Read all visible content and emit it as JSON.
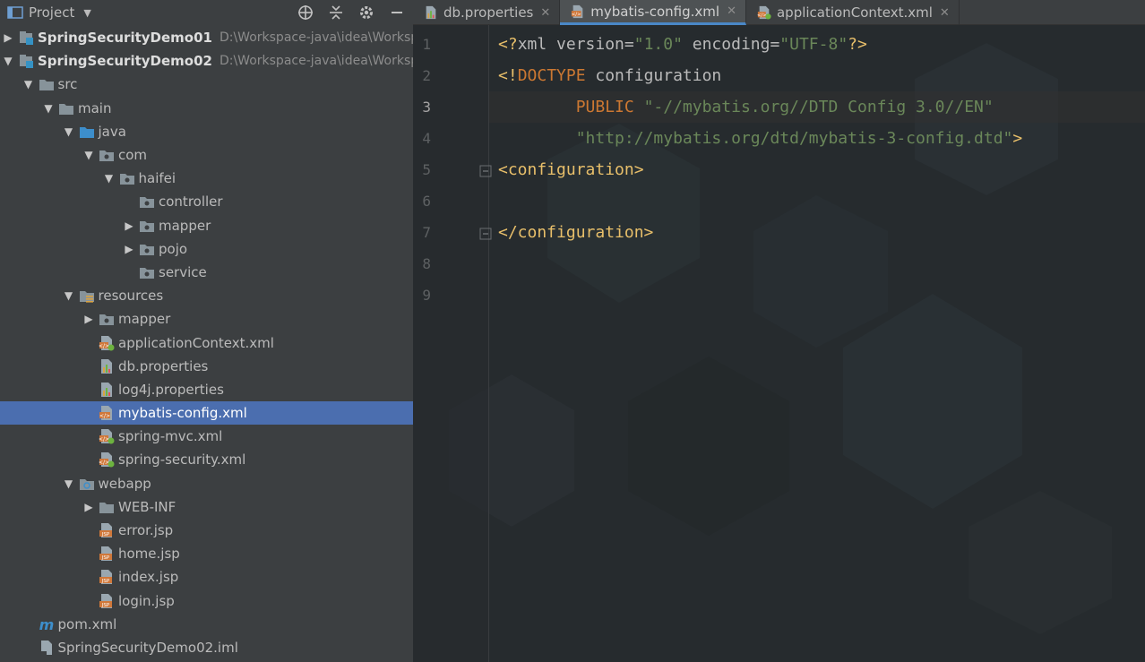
{
  "project_panel": {
    "title": "Project",
    "tree": [
      {
        "label": "SpringSecurityDemo01",
        "path": "D:\\Workspace-java\\idea\\Worksp",
        "depth": 0,
        "arrow": "right",
        "icon": "module-icon",
        "bold": true
      },
      {
        "label": "SpringSecurityDemo02",
        "path": "D:\\Workspace-java\\idea\\Worksp",
        "depth": 0,
        "arrow": "down",
        "icon": "module-icon",
        "bold": true
      },
      {
        "label": "src",
        "depth": 1,
        "arrow": "down",
        "icon": "folder-icon"
      },
      {
        "label": "main",
        "depth": 2,
        "arrow": "down",
        "icon": "folder-icon"
      },
      {
        "label": "java",
        "depth": 3,
        "arrow": "down",
        "icon": "source-folder-icon"
      },
      {
        "label": "com",
        "depth": 4,
        "arrow": "down",
        "icon": "package-icon"
      },
      {
        "label": "haifei",
        "depth": 5,
        "arrow": "down",
        "icon": "package-icon"
      },
      {
        "label": "controller",
        "depth": 6,
        "arrow": "none",
        "icon": "package-icon"
      },
      {
        "label": "mapper",
        "depth": 6,
        "arrow": "right",
        "icon": "package-icon"
      },
      {
        "label": "pojo",
        "depth": 6,
        "arrow": "right",
        "icon": "package-icon"
      },
      {
        "label": "service",
        "depth": 6,
        "arrow": "none",
        "icon": "package-icon"
      },
      {
        "label": "resources",
        "depth": 3,
        "arrow": "down",
        "icon": "resources-folder-icon"
      },
      {
        "label": "mapper",
        "depth": 4,
        "arrow": "right",
        "icon": "package-icon"
      },
      {
        "label": "applicationContext.xml",
        "depth": 4,
        "arrow": "none",
        "icon": "spring-xml-icon"
      },
      {
        "label": "db.properties",
        "depth": 4,
        "arrow": "none",
        "icon": "properties-icon"
      },
      {
        "label": "log4j.properties",
        "depth": 4,
        "arrow": "none",
        "icon": "properties-icon"
      },
      {
        "label": "mybatis-config.xml",
        "depth": 4,
        "arrow": "none",
        "icon": "xml-icon",
        "selected": true
      },
      {
        "label": "spring-mvc.xml",
        "depth": 4,
        "arrow": "none",
        "icon": "spring-xml-icon"
      },
      {
        "label": "spring-security.xml",
        "depth": 4,
        "arrow": "none",
        "icon": "spring-xml-icon"
      },
      {
        "label": "webapp",
        "depth": 3,
        "arrow": "down",
        "icon": "web-folder-icon"
      },
      {
        "label": "WEB-INF",
        "depth": 4,
        "arrow": "right",
        "icon": "folder-icon"
      },
      {
        "label": "error.jsp",
        "depth": 4,
        "arrow": "none",
        "icon": "jsp-icon"
      },
      {
        "label": "home.jsp",
        "depth": 4,
        "arrow": "none",
        "icon": "jsp-icon"
      },
      {
        "label": "index.jsp",
        "depth": 4,
        "arrow": "none",
        "icon": "jsp-icon"
      },
      {
        "label": "login.jsp",
        "depth": 4,
        "arrow": "none",
        "icon": "jsp-icon"
      },
      {
        "label": "pom.xml",
        "depth": 1,
        "arrow": "none",
        "icon": "maven-icon"
      },
      {
        "label": "SpringSecurityDemo02.iml",
        "depth": 1,
        "arrow": "none",
        "icon": "iml-icon"
      }
    ]
  },
  "tabs": [
    {
      "label": "db.properties",
      "icon": "properties-icon",
      "active": false
    },
    {
      "label": "mybatis-config.xml",
      "icon": "xml-icon",
      "active": true
    },
    {
      "label": "applicationContext.xml",
      "icon": "spring-xml-icon",
      "active": false
    }
  ],
  "editor": {
    "current_line": 3,
    "lines": [
      {
        "n": "1",
        "tokens": [
          [
            "punct",
            "<?"
          ],
          [
            "attr",
            "xml version="
          ],
          [
            "str",
            "\"1.0\""
          ],
          [
            "attr",
            " encoding="
          ],
          [
            "str",
            "\"UTF-8\""
          ],
          [
            "punct",
            "?>"
          ]
        ]
      },
      {
        "n": "2",
        "tokens": [
          [
            "punct",
            "<!"
          ],
          [
            "kw",
            "DOCTYPE"
          ],
          [
            "attr",
            " configuration"
          ]
        ]
      },
      {
        "n": "3",
        "tokens": [
          [
            "text",
            "        "
          ],
          [
            "kw",
            "PUBLIC"
          ],
          [
            "attr",
            " "
          ],
          [
            "str",
            "\"-//mybatis.org//DTD Config 3.0//EN\""
          ]
        ]
      },
      {
        "n": "4",
        "tokens": [
          [
            "text",
            "        "
          ],
          [
            "str",
            "\"http://mybatis.org/dtd/mybatis-3-config.dtd\""
          ],
          [
            "punct",
            ">"
          ]
        ]
      },
      {
        "n": "5",
        "tokens": [
          [
            "tag",
            "<configuration>"
          ]
        ]
      },
      {
        "n": "6",
        "tokens": []
      },
      {
        "n": "7",
        "tokens": [
          [
            "tag",
            "</configuration>"
          ]
        ]
      },
      {
        "n": "8",
        "tokens": []
      },
      {
        "n": "9",
        "tokens": []
      }
    ]
  },
  "colors": {
    "panel_bg": "#3c3f41",
    "editor_bg": "#262b2e",
    "selection": "#4b6eaf",
    "accent": "#4a88c7"
  }
}
